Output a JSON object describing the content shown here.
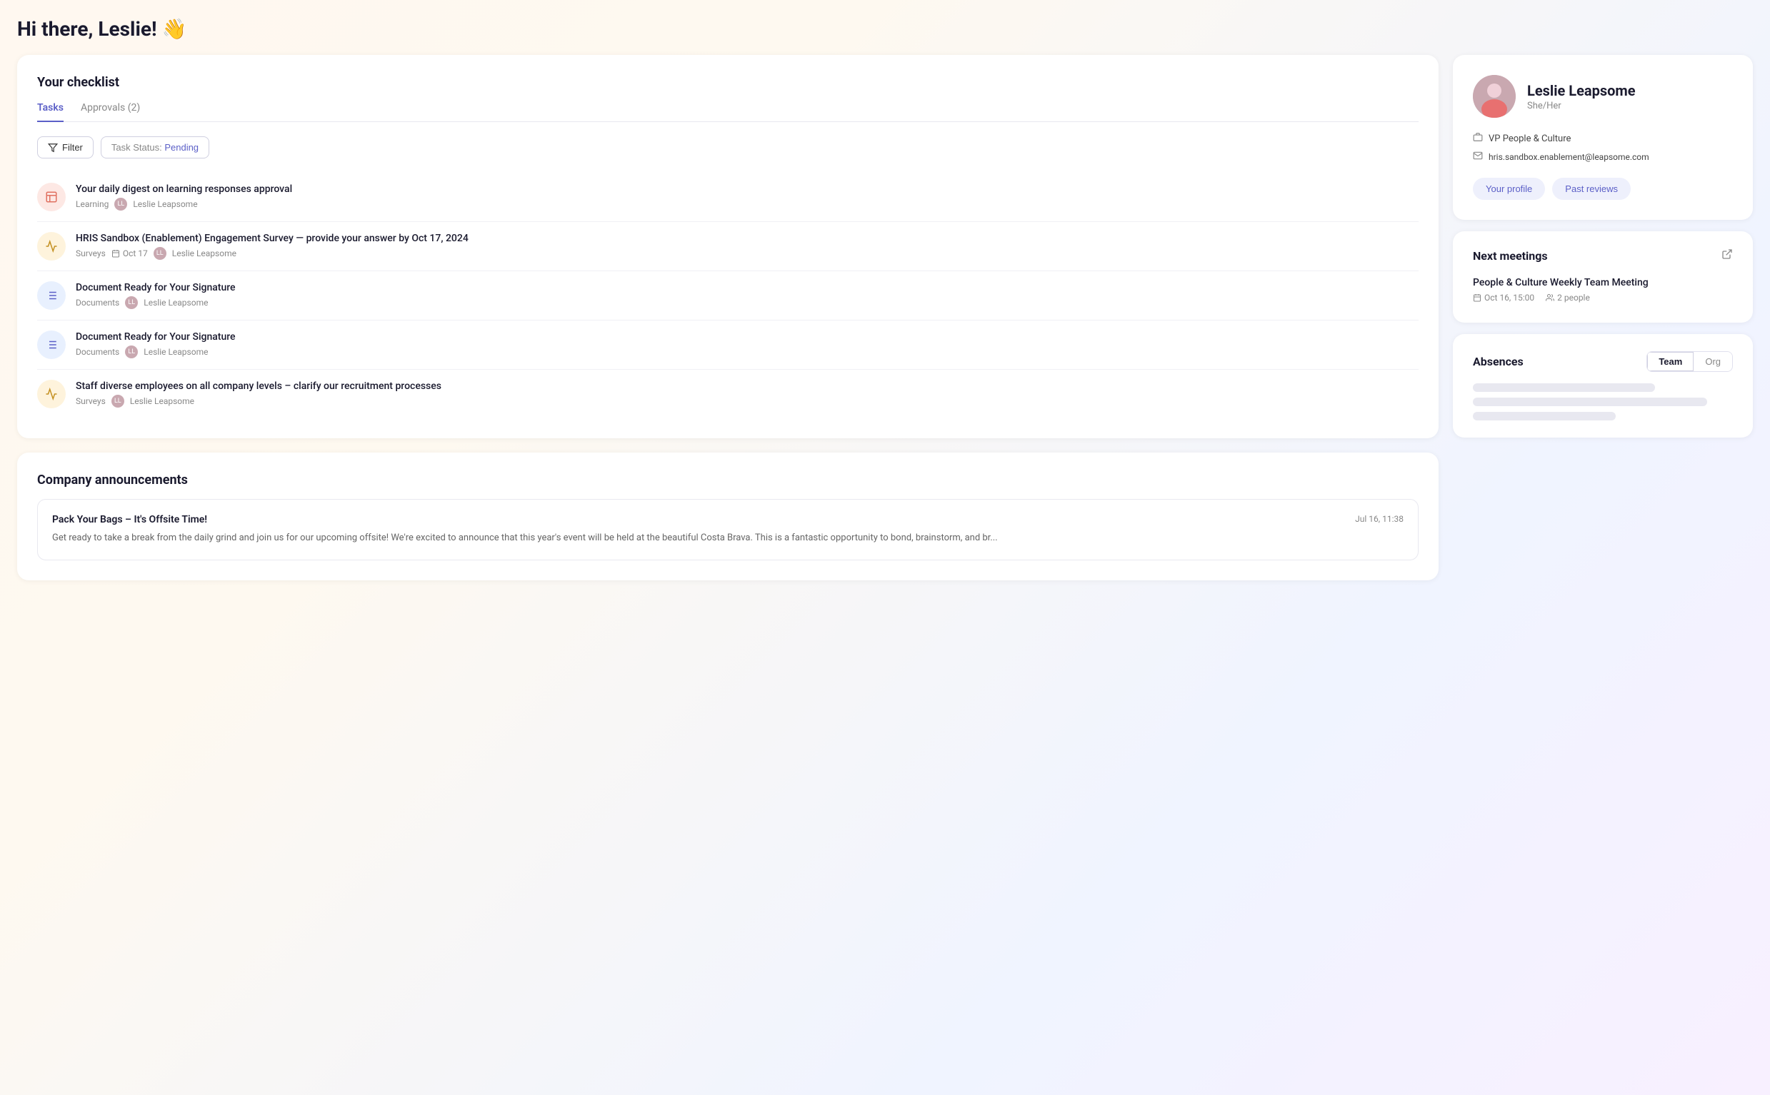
{
  "header": {
    "greeting": "Hi there, Leslie! 👋"
  },
  "checklist": {
    "title": "Your checklist",
    "tabs": [
      {
        "label": "Tasks",
        "active": true
      },
      {
        "label": "Approvals (2)",
        "active": false
      }
    ],
    "filter_label": "Filter",
    "status_label": "Task Status:",
    "status_value": "Pending",
    "tasks": [
      {
        "id": 1,
        "icon_type": "learning",
        "icon_symbol": "📖",
        "title": "Your daily digest on learning responses approval",
        "tag": "Learning",
        "assignee": "Leslie Leapsome",
        "has_date": false
      },
      {
        "id": 2,
        "icon_type": "survey",
        "icon_symbol": "📊",
        "title": "HRIS Sandbox (Enablement) Engagement Survey — provide your answer by Oct 17, 2024",
        "tag": "Surveys",
        "assignee": "Leslie Leapsome",
        "has_date": true,
        "date": "Oct 17"
      },
      {
        "id": 3,
        "icon_type": "document",
        "icon_symbol": "📋",
        "title": "Document Ready for Your Signature",
        "tag": "Documents",
        "assignee": "Leslie Leapsome",
        "has_date": false
      },
      {
        "id": 4,
        "icon_type": "document",
        "icon_symbol": "📋",
        "title": "Document Ready for Your Signature",
        "tag": "Documents",
        "assignee": "Leslie Leapsome",
        "has_date": false
      },
      {
        "id": 5,
        "icon_type": "survey",
        "icon_symbol": "📊",
        "title": "Staff diverse employees on all company levels – clarify our recruitment processes",
        "tag": "Surveys",
        "assignee": "Leslie Leapsome",
        "has_date": false
      }
    ]
  },
  "announcements": {
    "title": "Company announcements",
    "items": [
      {
        "title": "Pack Your Bags – It's Offsite Time!",
        "date": "Jul 16, 11:38",
        "body": "Get ready to take a break from the daily grind and join us for our upcoming offsite! We're excited to announce that this year's event will be held at the beautiful Costa Brava. This is a fantastic opportunity to bond, brainstorm, and br..."
      }
    ]
  },
  "profile": {
    "name": "Leslie Leapsome",
    "pronouns": "She/Her",
    "role": "VP People & Culture",
    "email": "hris.sandbox.enablement@leapsome.com",
    "avatar_initials": "LL",
    "btn_profile": "Your profile",
    "btn_past_reviews": "Past reviews"
  },
  "meetings": {
    "title": "Next meetings",
    "items": [
      {
        "name": "People & Culture Weekly Team Meeting",
        "date": "Oct 16, 15:00",
        "attendees": "2 people"
      }
    ]
  },
  "absences": {
    "title": "Absences",
    "toggle": {
      "team_label": "Team",
      "org_label": "Org",
      "active": "Team"
    }
  }
}
